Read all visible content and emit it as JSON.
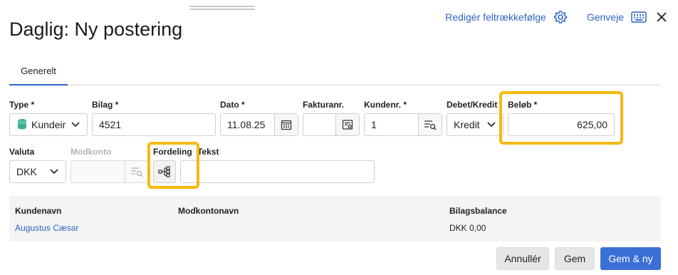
{
  "header": {
    "title": "Daglig: Ny postering",
    "edit_field_order": "Redigér feltrækkefølge",
    "shortcuts": "Genveje"
  },
  "tabs": [
    {
      "label": "Generelt"
    }
  ],
  "form": {
    "type": {
      "label": "Type *",
      "value": "Kundeir"
    },
    "bilag": {
      "label": "Bilag *",
      "value": "4521"
    },
    "dato": {
      "label": "Dato *",
      "value": "11.08.25"
    },
    "fakturanr": {
      "label": "Fakturanr.",
      "value": ""
    },
    "kundenr": {
      "label": "Kundenr. *",
      "value": "1"
    },
    "debet_kredit": {
      "label": "Debet/Kredit",
      "value": "Kredit"
    },
    "belob": {
      "label": "Beløb *",
      "value": "625,00"
    },
    "valuta": {
      "label": "Valuta",
      "value": "DKK"
    },
    "modkonto": {
      "label": "Modkonto",
      "value": ""
    },
    "fordeling": {
      "label": "Fordeling"
    },
    "tekst": {
      "label": "Tekst",
      "value": ""
    }
  },
  "summary": {
    "headers": [
      "Kundenavn",
      "Modkontonavn",
      "Bilagsbalance"
    ],
    "values": {
      "kundenavn": "Augustus Cæsar",
      "modkontonavn": "",
      "bilagsbalance": "DKK 0,00"
    }
  },
  "footer": {
    "cancel": "Annullér",
    "save": "Gem",
    "save_new": "Gem & ny"
  },
  "colors": {
    "accent": "#2f63c4",
    "primary_button": "#3a70d6",
    "highlight": "#f5b90f",
    "type_icon": "#3fae8f"
  },
  "icons": [
    "gear-icon",
    "keyboard-icon",
    "close-icon",
    "database-icon",
    "chevron-down-icon",
    "calendar-icon",
    "invoice-icon",
    "lookup-list-icon",
    "hierarchy-icon"
  ]
}
